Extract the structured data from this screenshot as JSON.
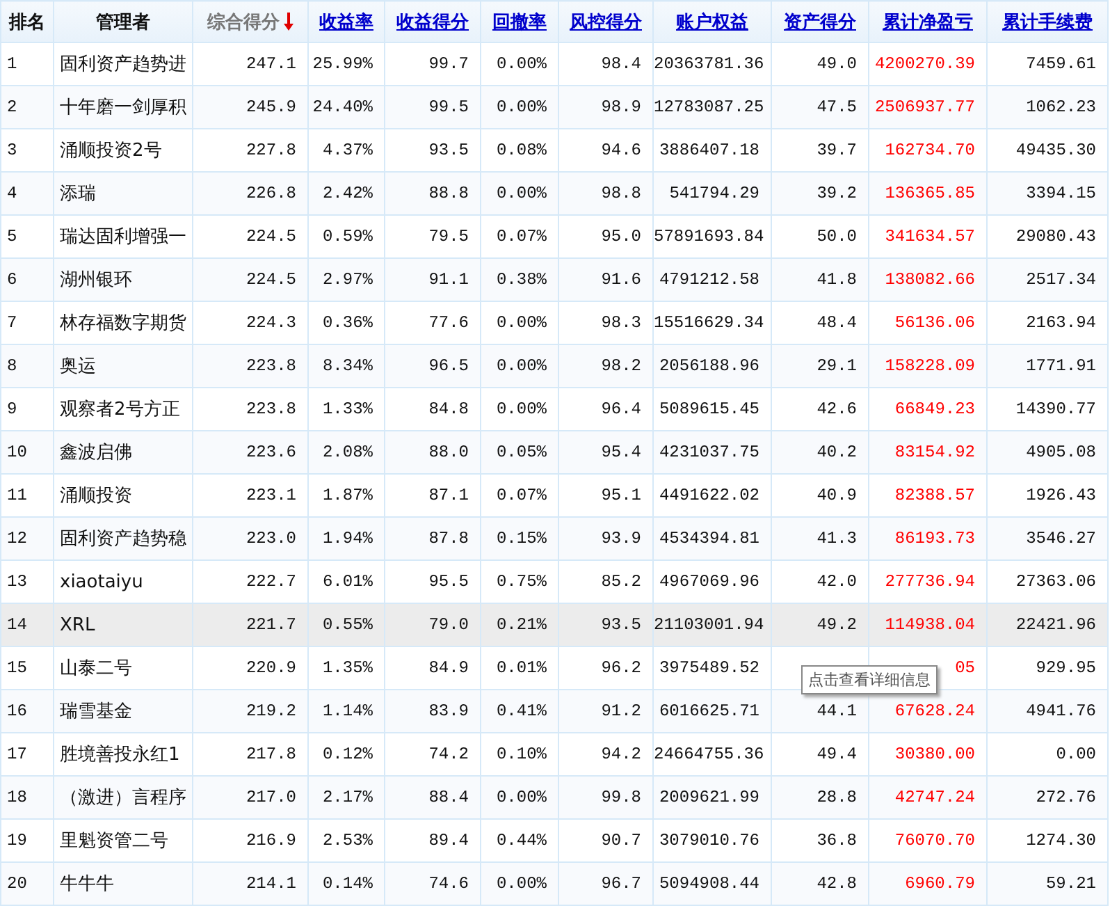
{
  "table": {
    "columns": [
      {
        "label": "排名",
        "kind": "plain"
      },
      {
        "label": "管理者",
        "kind": "plain"
      },
      {
        "label": "综合得分",
        "kind": "sorted"
      },
      {
        "label": "收益率",
        "kind": "link"
      },
      {
        "label": "收益得分",
        "kind": "link"
      },
      {
        "label": "回撤率",
        "kind": "link"
      },
      {
        "label": "风控得分",
        "kind": "link"
      },
      {
        "label": "账户权益",
        "kind": "link"
      },
      {
        "label": "资产得分",
        "kind": "link"
      },
      {
        "label": "累计净盈亏",
        "kind": "link"
      },
      {
        "label": "累计手续费",
        "kind": "link"
      }
    ],
    "rows": [
      {
        "highlighted": false,
        "cells": [
          "1",
          "固利资产趋势进",
          "247.1",
          "25.99%",
          "99.7",
          "0.00%",
          "98.4",
          "20363781.36",
          "49.0",
          "4200270.39",
          "7459.61"
        ]
      },
      {
        "highlighted": false,
        "cells": [
          "2",
          "十年磨一剑厚积",
          "245.9",
          "24.40%",
          "99.5",
          "0.00%",
          "98.9",
          "12783087.25",
          "47.5",
          "2506937.77",
          "1062.23"
        ]
      },
      {
        "highlighted": false,
        "cells": [
          "3",
          "涌顺投资2号",
          "227.8",
          "4.37%",
          "93.5",
          "0.08%",
          "94.6",
          "3886407.18",
          "39.7",
          "162734.70",
          "49435.30"
        ]
      },
      {
        "highlighted": false,
        "cells": [
          "4",
          "添瑞",
          "226.8",
          "2.42%",
          "88.8",
          "0.00%",
          "98.8",
          "541794.29",
          "39.2",
          "136365.85",
          "3394.15"
        ]
      },
      {
        "highlighted": false,
        "cells": [
          "5",
          "瑞达固利增强一",
          "224.5",
          "0.59%",
          "79.5",
          "0.07%",
          "95.0",
          "57891693.84",
          "50.0",
          "341634.57",
          "29080.43"
        ]
      },
      {
        "highlighted": false,
        "cells": [
          "6",
          "湖州银环",
          "224.5",
          "2.97%",
          "91.1",
          "0.38%",
          "91.6",
          "4791212.58",
          "41.8",
          "138082.66",
          "2517.34"
        ]
      },
      {
        "highlighted": false,
        "cells": [
          "7",
          "林存福数字期货",
          "224.3",
          "0.36%",
          "77.6",
          "0.00%",
          "98.3",
          "15516629.34",
          "48.4",
          "56136.06",
          "2163.94"
        ]
      },
      {
        "highlighted": false,
        "cells": [
          "8",
          "奥运",
          "223.8",
          "8.34%",
          "96.5",
          "0.00%",
          "98.2",
          "2056188.96",
          "29.1",
          "158228.09",
          "1771.91"
        ]
      },
      {
        "highlighted": false,
        "cells": [
          "9",
          "观察者2号方正",
          "223.8",
          "1.33%",
          "84.8",
          "0.00%",
          "96.4",
          "5089615.45",
          "42.6",
          "66849.23",
          "14390.77"
        ]
      },
      {
        "highlighted": false,
        "cells": [
          "10",
          "鑫波启佛",
          "223.6",
          "2.08%",
          "88.0",
          "0.05%",
          "95.4",
          "4231037.75",
          "40.2",
          "83154.92",
          "4905.08"
        ]
      },
      {
        "highlighted": false,
        "cells": [
          "11",
          "涌顺投资",
          "223.1",
          "1.87%",
          "87.1",
          "0.07%",
          "95.1",
          "4491622.02",
          "40.9",
          "82388.57",
          "1926.43"
        ]
      },
      {
        "highlighted": false,
        "cells": [
          "12",
          "固利资产趋势稳",
          "223.0",
          "1.94%",
          "87.8",
          "0.15%",
          "93.9",
          "4534394.81",
          "41.3",
          "86193.73",
          "3546.27"
        ]
      },
      {
        "highlighted": false,
        "cells": [
          "13",
          "xiaotaiyu",
          "222.7",
          "6.01%",
          "95.5",
          "0.75%",
          "85.2",
          "4967069.96",
          "42.0",
          "277736.94",
          "27363.06"
        ]
      },
      {
        "highlighted": true,
        "cells": [
          "14",
          "XRL",
          "221.7",
          "0.55%",
          "79.0",
          "0.21%",
          "93.5",
          "21103001.94",
          "49.2",
          "114938.04",
          "22421.96"
        ]
      },
      {
        "highlighted": false,
        "cells": [
          "15",
          "山泰二号",
          "220.9",
          "1.35%",
          "84.9",
          "0.01%",
          "96.2",
          "3975489.52",
          null,
          "05",
          "929.95"
        ]
      },
      {
        "highlighted": false,
        "cells": [
          "16",
          "瑞雪基金",
          "219.2",
          "1.14%",
          "83.9",
          "0.41%",
          "91.2",
          "6016625.71",
          "44.1",
          "67628.24",
          "4941.76"
        ]
      },
      {
        "highlighted": false,
        "cells": [
          "17",
          "胜境善投永红1",
          "217.8",
          "0.12%",
          "74.2",
          "0.10%",
          "94.2",
          "24664755.36",
          "49.4",
          "30380.00",
          "0.00"
        ]
      },
      {
        "highlighted": false,
        "cells": [
          "18",
          "（激进）言程序",
          "217.0",
          "2.17%",
          "88.4",
          "0.00%",
          "99.8",
          "2009621.99",
          "28.8",
          "42747.24",
          "272.76"
        ]
      },
      {
        "highlighted": false,
        "cells": [
          "19",
          "里魁资管二号",
          "216.9",
          "2.53%",
          "89.4",
          "0.44%",
          "90.7",
          "3079010.76",
          "36.8",
          "76070.70",
          "1274.30"
        ]
      },
      {
        "highlighted": false,
        "cells": [
          "20",
          "牛牛牛",
          "214.1",
          "0.14%",
          "74.6",
          "0.00%",
          "96.7",
          "5094908.44",
          "42.8",
          "6960.79",
          "59.21"
        ]
      }
    ]
  },
  "tooltip": {
    "text": "点击查看详细信息"
  }
}
